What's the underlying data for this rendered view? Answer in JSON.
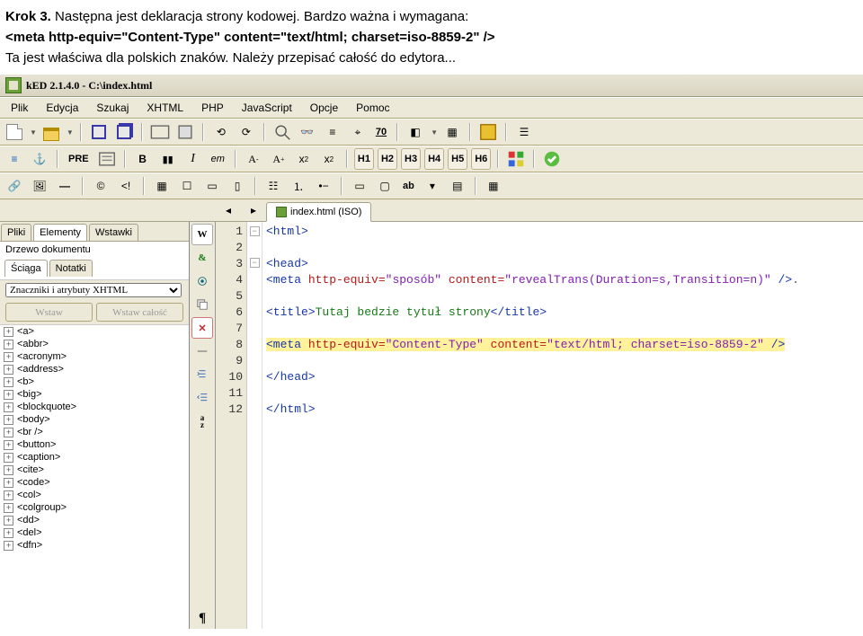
{
  "doc": {
    "line1_a": "Krok 3. ",
    "line1_b": "Następna jest deklaracja strony kodowej. Bardzo ważna i wymagana:",
    "line2": "<meta http-equiv=\"Content-Type\" content=\"text/html; charset=iso-8859-2\" />",
    "line3": "Ta jest właściwa dla polskich znaków. Należy przepisać całość do edytora..."
  },
  "app": {
    "title": "kED 2.1.4.0 - C:\\index.html"
  },
  "menu": [
    "Plik",
    "Edycja",
    "Szukaj",
    "XHTML",
    "PHP",
    "JavaScript",
    "Opcje",
    "Pomoc"
  ],
  "tb2": {
    "pre": "PRE",
    "bold": "B",
    "ital": "I",
    "em": "em",
    "aminus": "A",
    "aplus": "A",
    "sup": "x",
    "sub": "x",
    "h1": "H1",
    "h2": "H2",
    "h3": "H3",
    "h4": "H4",
    "h5": "H5",
    "h6": "H6"
  },
  "tb3": {
    "ab": "ab"
  },
  "sidebar": {
    "tabs": [
      "Pliki",
      "Elementy",
      "Wstawki"
    ],
    "tabs2": [
      "Ściąga",
      "Notatki"
    ],
    "tree_label": "Drzewo dokumentu",
    "select": "Znaczniki i atrybuty XHTML",
    "btn_insert": "Wstaw",
    "btn_insert_all": "Wstaw całość",
    "nodes": [
      "<a>",
      "<abbr>",
      "<acronym>",
      "<address>",
      "<b>",
      "<big>",
      "<blockquote>",
      "<body>",
      "<br />",
      "<button>",
      "<caption>",
      "<cite>",
      "<code>",
      "<col>",
      "<colgroup>",
      "<dd>",
      "<del>",
      "<dfn>"
    ]
  },
  "editor_tab": "index.html (ISO)",
  "vtool": [
    "W",
    "&",
    "",
    "",
    "✕",
    "",
    "",
    "",
    ""
  ],
  "gutter": [
    "1",
    "2",
    "3",
    "4",
    "5",
    "6",
    "7",
    "8",
    "9",
    "10",
    "11",
    "12"
  ],
  "code": {
    "l1": {
      "tag": "<html>"
    },
    "l3": {
      "tag": "<head>"
    },
    "l4": {
      "a": "<meta ",
      "b": "http-equiv=",
      "c": "\"sposób\"",
      "d": " content=",
      "e": "\"revealTrans(Duration=s,Transition=n)\"",
      "f": " />",
      "dot": "."
    },
    "l6": {
      "a": "<title>",
      "b": "Tutaj bedzie tytuł strony",
      "c": "</title>"
    },
    "l8": {
      "a": "<meta ",
      "b": "http-equiv=",
      "c": "\"Content-Type\"",
      "d": " content=",
      "e": "\"text/html; charset=iso-8859-2\"",
      "f": " />"
    },
    "l10": {
      "tag": "</head>"
    },
    "l12": {
      "tag": "</html>"
    }
  }
}
